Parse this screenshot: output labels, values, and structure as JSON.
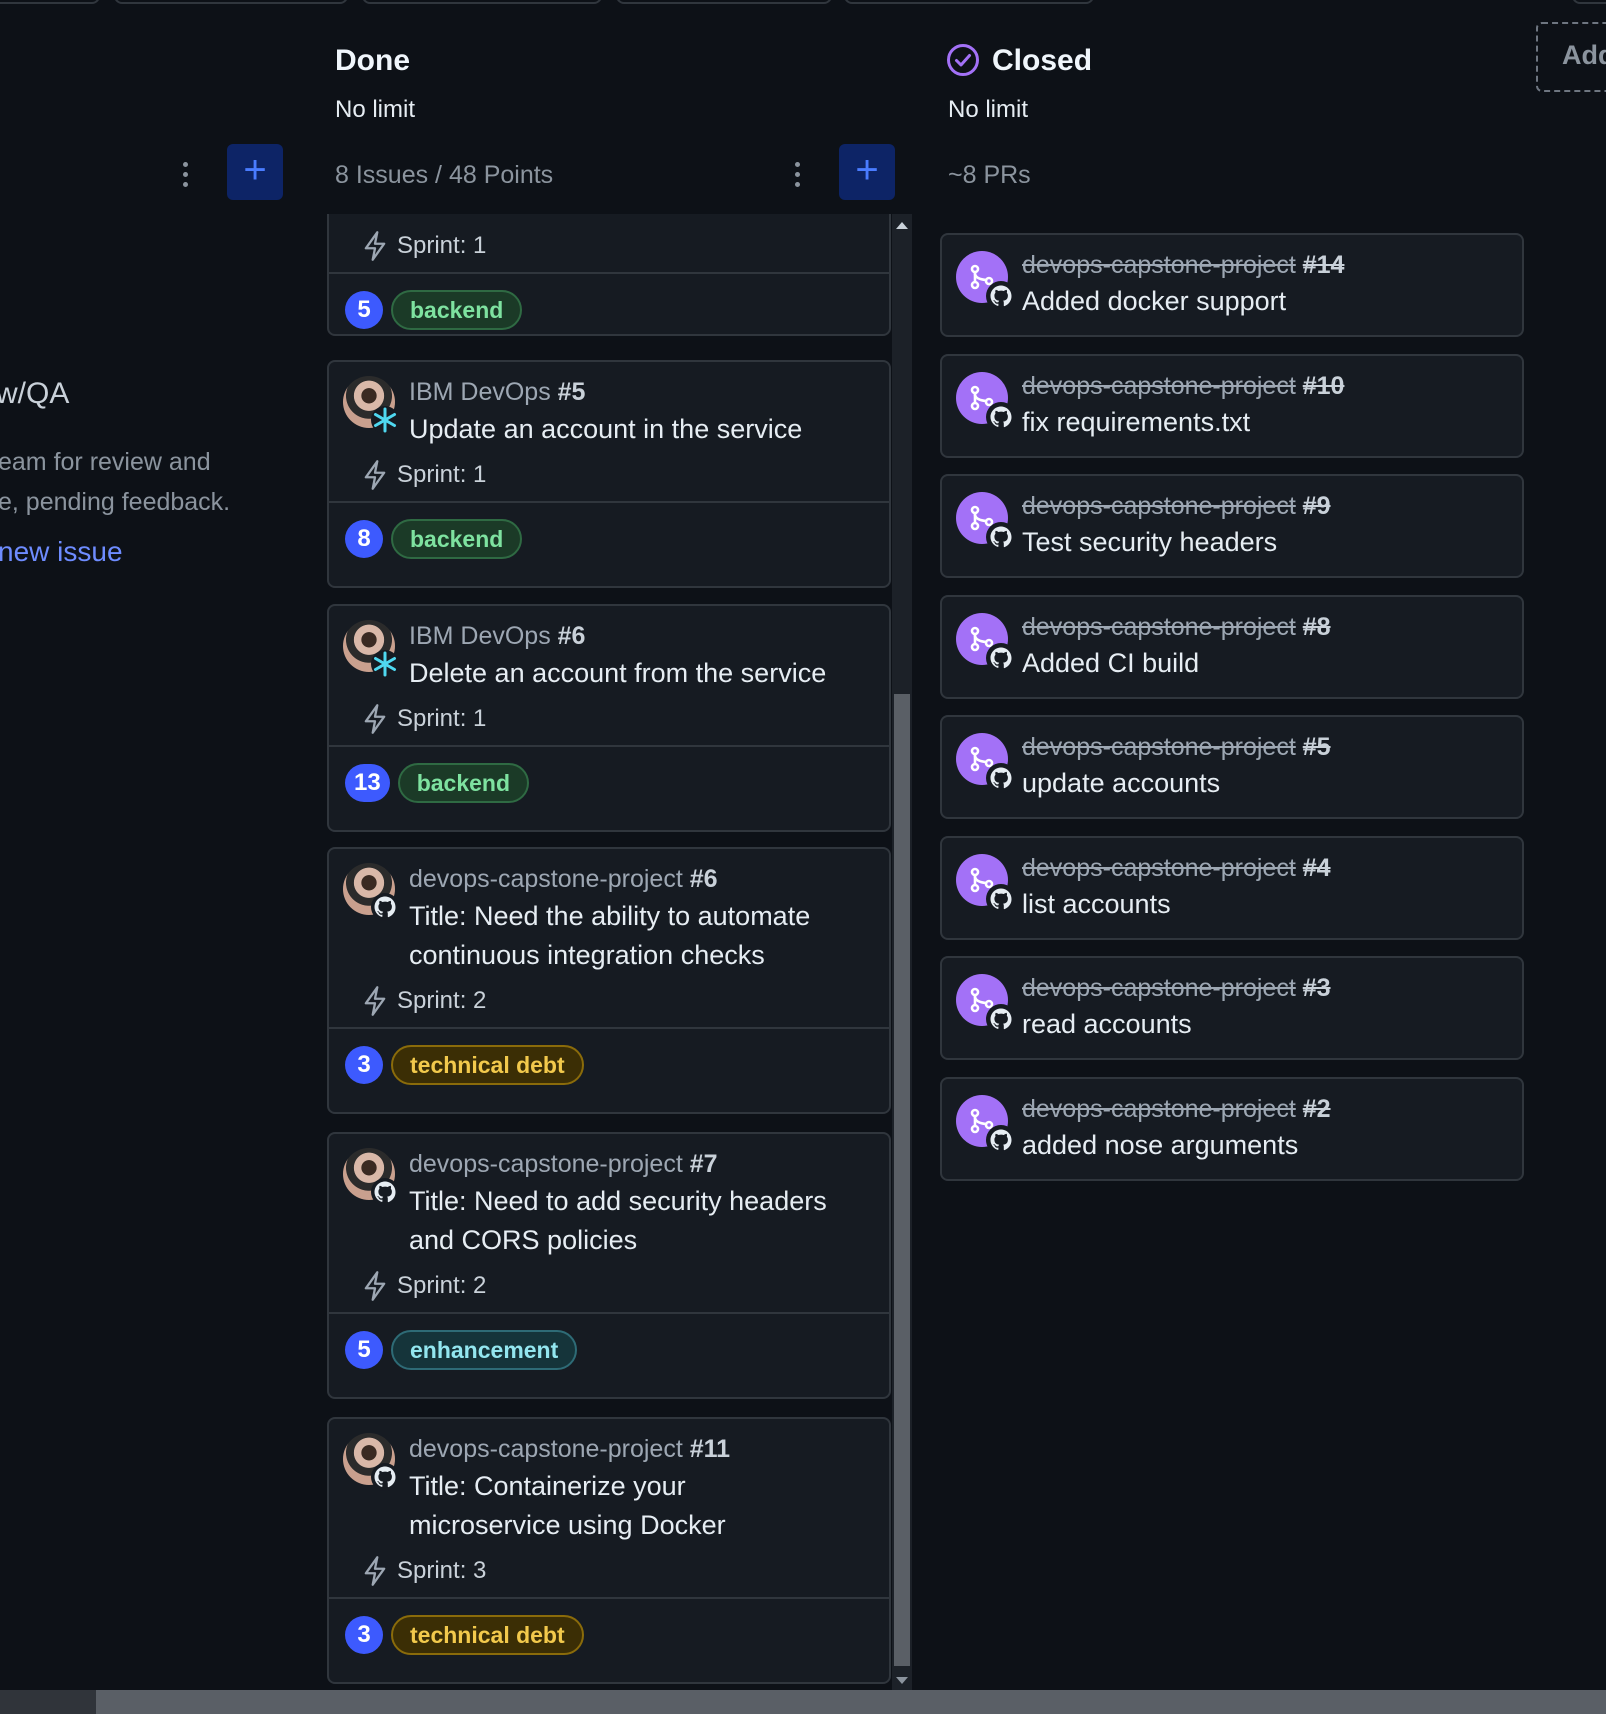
{
  "left_column": {
    "empty_title": "w/QA",
    "empty_desc_1": "eam for review and",
    "empty_desc_2": "e, pending feedback.",
    "empty_link": "new issue"
  },
  "done_column": {
    "title": "Done",
    "limit": "No limit",
    "count": "8 Issues / 48 Points",
    "partial_card": {
      "sprint": "Sprint: 1",
      "points": "5",
      "label": "backend"
    },
    "cards": [
      {
        "repo": "IBM DevOps",
        "number": "#5",
        "title_lines": [
          "Update an account in the service"
        ],
        "sprint": "Sprint: 1",
        "points": "8",
        "label": "backend",
        "label_kind": "backend",
        "badge": "asterisk-icon"
      },
      {
        "repo": "IBM DevOps",
        "number": "#6",
        "title_lines": [
          "Delete an account from the service"
        ],
        "sprint": "Sprint: 1",
        "points": "13",
        "label": "backend",
        "label_kind": "backend",
        "badge": "asterisk-icon"
      },
      {
        "repo": "devops-capstone-project",
        "number": "#6",
        "title_lines": [
          "Title: Need the ability to automate",
          "continuous integration checks"
        ],
        "sprint": "Sprint: 2",
        "points": "3",
        "label": "technical debt",
        "label_kind": "debt",
        "badge": "github-icon"
      },
      {
        "repo": "devops-capstone-project",
        "number": "#7",
        "title_lines": [
          "Title: Need to add security headers",
          "and CORS policies"
        ],
        "sprint": "Sprint: 2",
        "points": "5",
        "label": "enhancement",
        "label_kind": "enh",
        "badge": "github-icon"
      },
      {
        "repo": "devops-capstone-project",
        "number": "#11",
        "title_lines": [
          "Title: Containerize your",
          "microservice using Docker"
        ],
        "sprint": "Sprint: 3",
        "points": "3",
        "label": "technical debt",
        "label_kind": "debt",
        "badge": "github-icon"
      }
    ]
  },
  "closed_column": {
    "title": "Closed",
    "limit": "No limit",
    "count": "~8 PRs",
    "prs": [
      {
        "repo": "devops-capstone-project",
        "number": "#14",
        "title": "Added docker support"
      },
      {
        "repo": "devops-capstone-project",
        "number": "#10",
        "title": "fix requirements.txt"
      },
      {
        "repo": "devops-capstone-project",
        "number": "#9",
        "title": "Test security headers"
      },
      {
        "repo": "devops-capstone-project",
        "number": "#8",
        "title": "Added CI build"
      },
      {
        "repo": "devops-capstone-project",
        "number": "#5",
        "title": "update accounts"
      },
      {
        "repo": "devops-capstone-project",
        "number": "#4",
        "title": "list accounts"
      },
      {
        "repo": "devops-capstone-project",
        "number": "#3",
        "title": "read accounts"
      },
      {
        "repo": "devops-capstone-project",
        "number": "#2",
        "title": "added nose arguments"
      }
    ]
  },
  "add_column_label": "Add",
  "icons": {
    "plus": "+",
    "sprint": "lightning-icon",
    "closed_status": "check-circle-icon",
    "pr": "git-pull-request-closed-icon"
  },
  "colors": {
    "background": "#0d1117",
    "card": "#161b22",
    "border": "#30363d",
    "accent_blue": "#3d5afe",
    "pr_purple": "#a371f7"
  }
}
